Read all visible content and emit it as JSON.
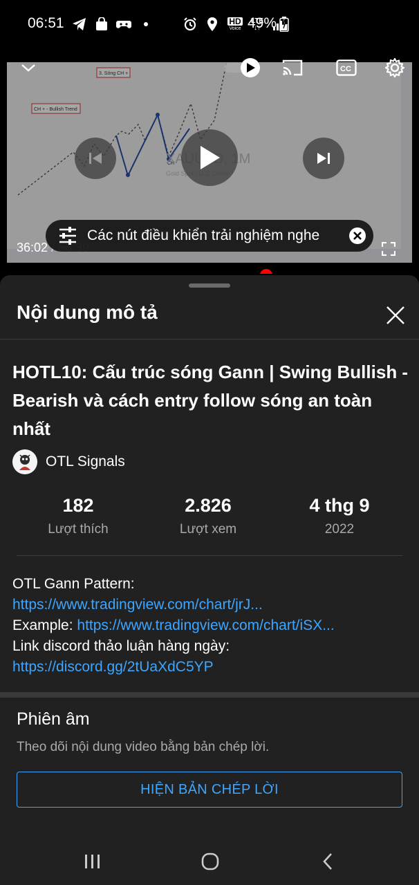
{
  "status_bar": {
    "time": "06:51",
    "battery": "49%",
    "icons_left": [
      "telegram-icon",
      "shopping-bag-icon",
      "game-controller-icon",
      "dot-icon"
    ],
    "icons_right": [
      "alarm-icon",
      "location-icon",
      "hd-voice-icon",
      "lte-icon",
      "signal-icon",
      "battery-icon"
    ],
    "hd_label": "HD",
    "voice_label": "Voice",
    "lte_label": "LTE"
  },
  "player": {
    "time_current": "36:02",
    "time_separator": "/",
    "time_total": "56:39",
    "progress": 0.636,
    "toast_text": "Các nút điều khiển trải nghiệm nghe",
    "chart_label_1": "3. Sóng CH +",
    "chart_label_2": "CH + - Bullish Trend",
    "chart_label_3": "CH",
    "watermark": "XAUUSD, 1M",
    "watermark_sub": "Gold Spot / U.S. Dollar",
    "colors": {
      "progress": "#ff0000",
      "accent": "#3ea6ff"
    }
  },
  "sheet": {
    "header_title": "Nội dung mô tả",
    "video_title": "HOTL10: Cấu trúc sóng Gann | Swing Bullish - Bearish và cách entry follow sóng an toàn nhất",
    "channel_name": "OTL Signals",
    "stats": [
      {
        "value": "182",
        "label": "Lượt thích"
      },
      {
        "value": "2.826",
        "label": "Lượt xem"
      },
      {
        "value": "4 thg 9",
        "label": "2022"
      }
    ],
    "description": {
      "line1": "OTL Gann Pattern:",
      "link1": "https://www.tradingview.com/chart/jrJ...",
      "line3_prefix": "Example:",
      "link2": "https://www.tradingview.com/chart/iSX...",
      "line4": "Link discord thảo luận hàng ngày:",
      "link3": "https://discord.gg/2tUaXdC5YP"
    },
    "transcript": {
      "title": "Phiên âm",
      "subtitle": "Theo dõi nội dung video bằng bản chép lời.",
      "button_label": "HIỆN BẢN CHÉP LỜI"
    }
  }
}
